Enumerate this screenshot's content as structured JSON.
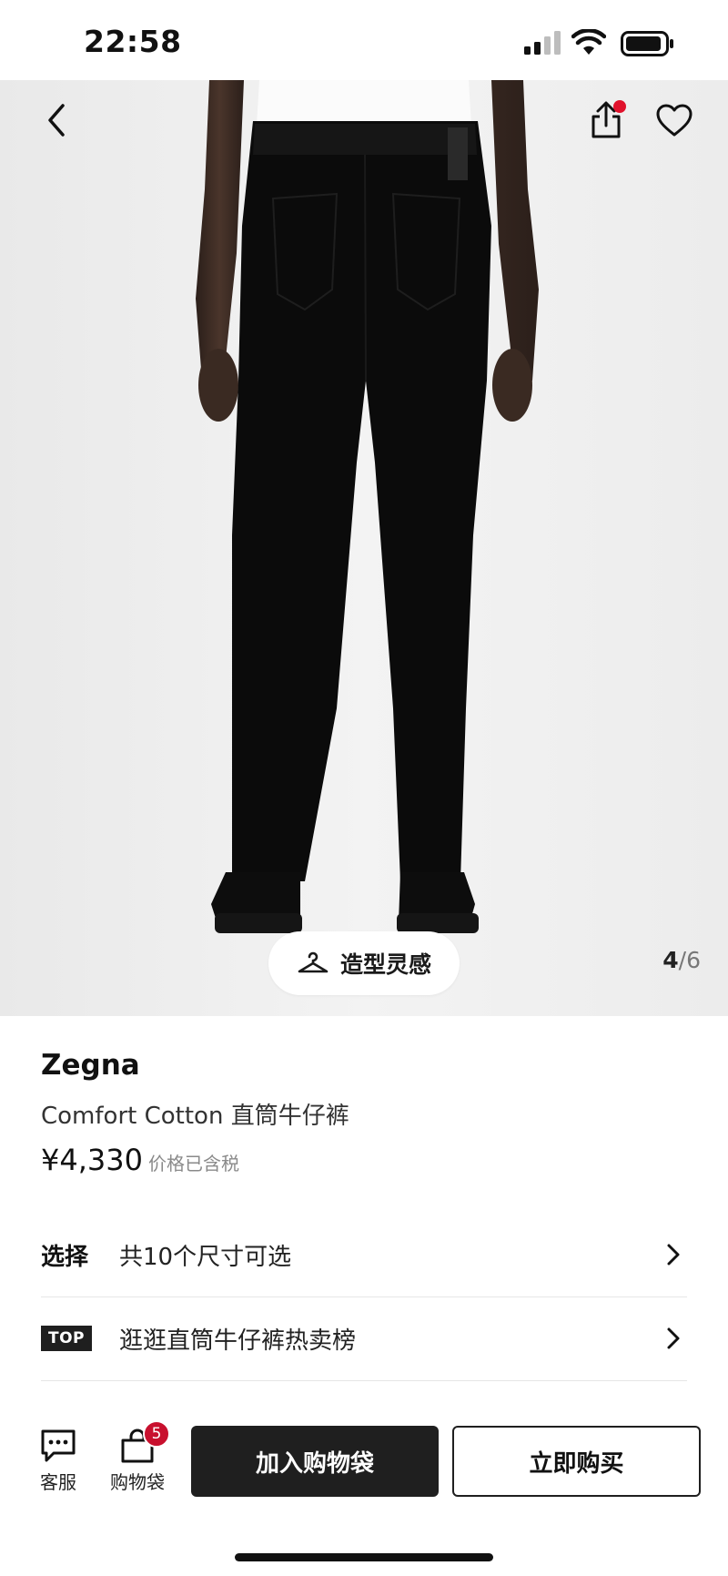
{
  "status_bar": {
    "time": "22:58"
  },
  "gallery": {
    "inspiration_label": "造型灵感",
    "current_index": "4",
    "separator": "/",
    "total": "6"
  },
  "product": {
    "brand": "Zegna",
    "name": "Comfort Cotton 直筒牛仔裤",
    "price": "¥4,330",
    "price_note": "价格已含税"
  },
  "options": {
    "size_label": "选择",
    "size_text": "共10个尺寸可选",
    "top_badge": "TOP",
    "ranking_text": "逛逛直筒牛仔裤热卖榜"
  },
  "bottom_bar": {
    "service_label": "客服",
    "bag_label": "购物袋",
    "bag_count": "5",
    "add_to_bag": "加入购物袋",
    "buy_now": "立即购买"
  },
  "icons": {
    "back": "chevron-left-icon",
    "share": "share-icon",
    "favorite": "heart-icon",
    "hanger": "hanger-icon",
    "service": "chat-bubble-icon",
    "bag": "shopping-bag-icon",
    "chevron": "chevron-right-icon"
  },
  "colors": {
    "accent_red": "#e0112b",
    "badge_red": "#c8102e",
    "primary_button": "#1f1f1f"
  }
}
